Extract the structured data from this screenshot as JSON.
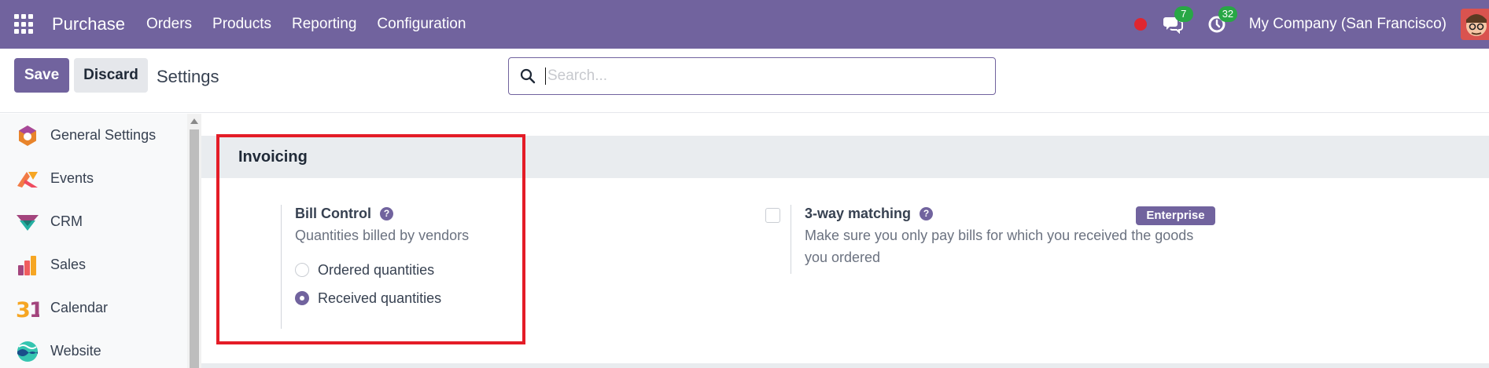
{
  "navbar": {
    "app_name": "Purchase",
    "menu": [
      "Orders",
      "Products",
      "Reporting",
      "Configuration"
    ],
    "messages_badge": "7",
    "activity_badge": "32",
    "company": "My Company (San Francisco)",
    "brand_color": "#71639e"
  },
  "control_panel": {
    "save_label": "Save",
    "discard_label": "Discard",
    "breadcrumb": "Settings",
    "search_placeholder": "Search..."
  },
  "sidebar": {
    "items": [
      {
        "label": "General Settings",
        "icon": "general-settings-icon"
      },
      {
        "label": "Events",
        "icon": "events-icon"
      },
      {
        "label": "CRM",
        "icon": "crm-icon"
      },
      {
        "label": "Sales",
        "icon": "sales-icon"
      },
      {
        "label": "Calendar",
        "icon": "calendar-icon"
      },
      {
        "label": "Website",
        "icon": "website-icon"
      }
    ]
  },
  "invoicing": {
    "section_title": "Invoicing",
    "bill_control": {
      "title": "Bill Control",
      "description": "Quantities billed by vendors",
      "options": [
        {
          "label": "Ordered quantities",
          "checked": false
        },
        {
          "label": "Received quantities",
          "checked": true
        }
      ]
    },
    "three_way_matching": {
      "title": "3-way matching",
      "description_line1": "Make sure you only pay bills for which you received the goods",
      "description_line2": "you ordered",
      "checked": false,
      "badge": "Enterprise"
    }
  }
}
